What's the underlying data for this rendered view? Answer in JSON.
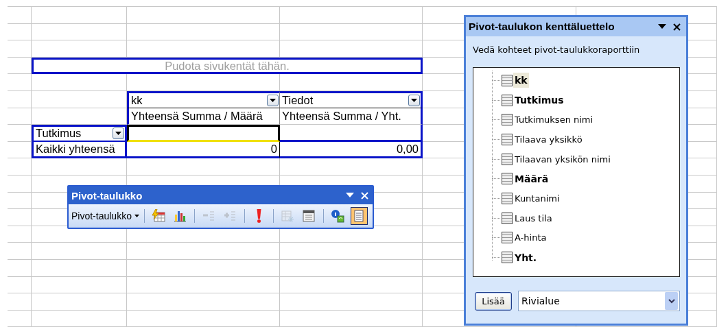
{
  "sheet": {
    "page_drop_zone": "Pudota sivukentät tähän.",
    "column_field": {
      "label": "kk"
    },
    "data_field": {
      "label": "Tiedot"
    },
    "data_headers": [
      "Yhteensä Summa / Määrä",
      "Yhteensä Summa / Yht."
    ],
    "row_field": {
      "label": "Tutkimus"
    },
    "data_cells": [
      {
        "selected": true
      },
      {
        "selected": false
      }
    ],
    "total_row": {
      "label": "Kaikki yhteensä",
      "values": [
        "0",
        "0,00"
      ]
    }
  },
  "pivot_toolbar": {
    "title": "Pivot-taulukko",
    "menu": "Pivot-taulukko",
    "groups": [
      [
        {
          "kind": "format",
          "disabled": false,
          "selected": false
        },
        {
          "kind": "chart",
          "disabled": false,
          "selected": false
        }
      ],
      [
        {
          "kind": "hide",
          "disabled": true,
          "selected": false
        },
        {
          "kind": "show",
          "disabled": true,
          "selected": false
        }
      ],
      [
        {
          "kind": "refresh",
          "disabled": false,
          "selected": false
        }
      ],
      [
        {
          "kind": "settings",
          "disabled": true,
          "selected": false
        },
        {
          "kind": "options",
          "disabled": false,
          "selected": false
        }
      ],
      [
        {
          "kind": "info",
          "disabled": false,
          "selected": false
        },
        {
          "kind": "fieldlist",
          "disabled": false,
          "selected": true
        }
      ]
    ]
  },
  "field_list": {
    "title": "Pivot-taulukon kenttäluettelo",
    "instruction": "Vedä kohteet pivot-taulukkoraporttiin",
    "fields": [
      {
        "label": "kk",
        "bold": true,
        "selected": true
      },
      {
        "label": "Tutkimus",
        "bold": true,
        "selected": false
      },
      {
        "label": "Tutkimuksen nimi",
        "bold": false,
        "selected": false
      },
      {
        "label": "Tilaava yksikkö",
        "bold": false,
        "selected": false
      },
      {
        "label": "Tilaavan yksikön nimi",
        "bold": false,
        "selected": false
      },
      {
        "label": "Määrä",
        "bold": true,
        "selected": false
      },
      {
        "label": "Kuntanimi",
        "bold": false,
        "selected": false
      },
      {
        "label": "Laus tila",
        "bold": false,
        "selected": false
      },
      {
        "label": "A-hinta",
        "bold": false,
        "selected": false
      },
      {
        "label": "Yht.",
        "bold": true,
        "selected": false
      }
    ],
    "add_button": "Lisää",
    "area": "Rivialue"
  }
}
